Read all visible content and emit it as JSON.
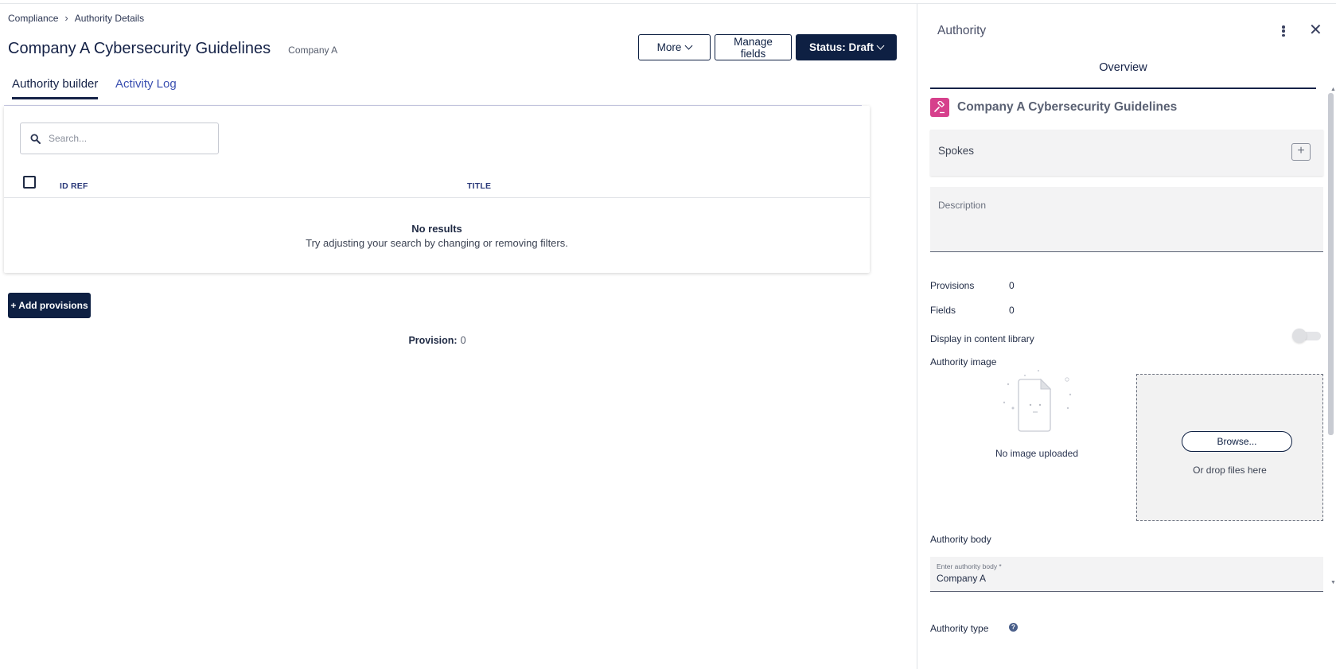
{
  "breadcrumb": {
    "root": "Compliance",
    "current": "Authority Details"
  },
  "page": {
    "title": "Company A Cybersecurity Guidelines",
    "subtitle": "Company A"
  },
  "actions": {
    "more": "More",
    "manage_fields": "Manage fields",
    "status": "Status: Draft"
  },
  "tabs": [
    {
      "label": "Authority builder",
      "active": true
    },
    {
      "label": "Activity Log",
      "active": false
    }
  ],
  "search": {
    "placeholder": "Search..."
  },
  "table": {
    "columns": [
      "ID REF",
      "TITLE"
    ],
    "rows": [],
    "empty_title": "No results",
    "empty_subtitle": "Try adjusting your search by changing or removing filters."
  },
  "add_provisions": "+ Add provisions",
  "provision_count": {
    "label": "Provision:",
    "value": "0"
  },
  "panel": {
    "title": "Authority",
    "tab": "Overview",
    "authority_name": "Company A Cybersecurity Guidelines",
    "spokes_label": "Spokes",
    "description_label": "Description",
    "provisions_label": "Provisions",
    "provisions_value": "0",
    "fields_label": "Fields",
    "fields_value": "0",
    "display_library_label": "Display in content library",
    "display_library_on": false,
    "image_label": "Authority image",
    "no_image_text": "No image uploaded",
    "browse_label": "Browse...",
    "drop_text": "Or drop files here",
    "body_label": "Authority body",
    "body_field_label": "Enter authority body *",
    "body_field_value": "Company A",
    "type_label": "Authority type"
  },
  "colors": {
    "primary": "#0e2043",
    "accent_link": "#3a4fb0",
    "badge": "#d6408c"
  },
  "icons": [
    "chevron-right-icon",
    "chevron-down-icon",
    "search-icon",
    "kebab-icon",
    "close-icon",
    "gavel-icon",
    "plus-icon",
    "file-placeholder-icon",
    "help-icon"
  ]
}
